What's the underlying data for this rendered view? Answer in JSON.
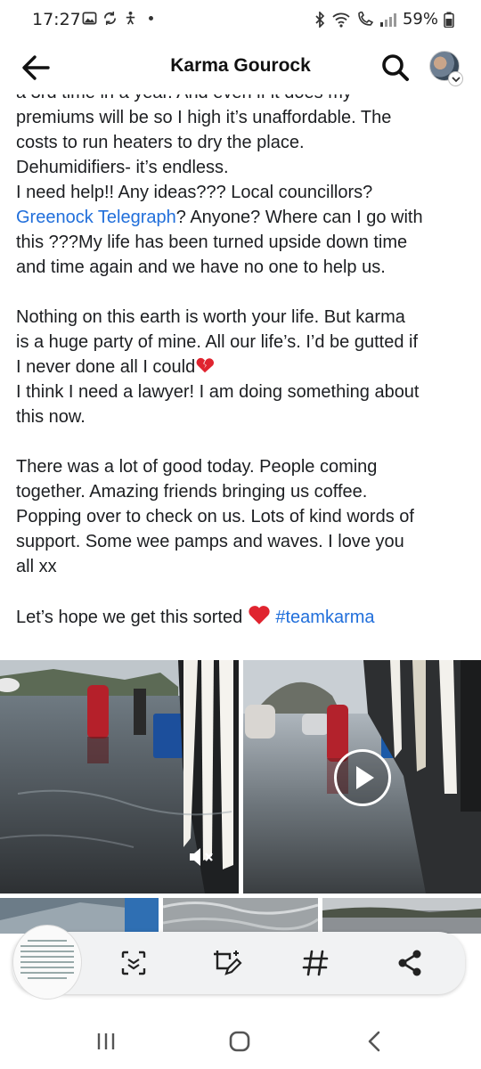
{
  "status": {
    "time": "17:27",
    "battery": "59%"
  },
  "header": {
    "title": "Karma Gourock"
  },
  "post": {
    "lines": [
      "a 3rd time in a year. And even if it does my",
      "premiums will be so I high it’s unaffordable. The",
      "costs to run heaters to dry the place.",
      "Dehumidifiers- it’s endless.",
      "I need help!! Any ideas??? Local councillors?"
    ],
    "link1": "Greenock Telegraph",
    "link1_after": "? Anyone? Where can I go with",
    "lines2": [
      "this ???My life has been turned upside down time",
      "and time again and we have no one to help us."
    ],
    "para2": [
      "Nothing on this earth is worth your life. But karma",
      "is a huge party of mine. All our life’s. I’d be gutted if"
    ],
    "para2_heart_line": "I never done all I could",
    "para2_rest": [
      "I think I need a lawyer! I am doing something about",
      "this now."
    ],
    "para3": [
      "There was a lot of good today. People coming",
      "together. Amazing friends bringing us coffee.",
      "Popping over to check on us. Lots of kind words of",
      "support. Some wee pamps and waves. I love you",
      "all xx"
    ],
    "closing": "Let’s hope we get this sorted",
    "hashtag": "#teamkarma"
  },
  "icons": {
    "back": "arrow-left-icon",
    "search": "search-icon",
    "mute": "volume-mute-icon",
    "play": "play-icon",
    "scan": "scan-text-icon",
    "edit": "edit-crop-icon",
    "hashtag": "hashtag-icon",
    "share": "share-icon"
  },
  "colors": {
    "link": "#216fdb",
    "heart": "#e0242f"
  }
}
